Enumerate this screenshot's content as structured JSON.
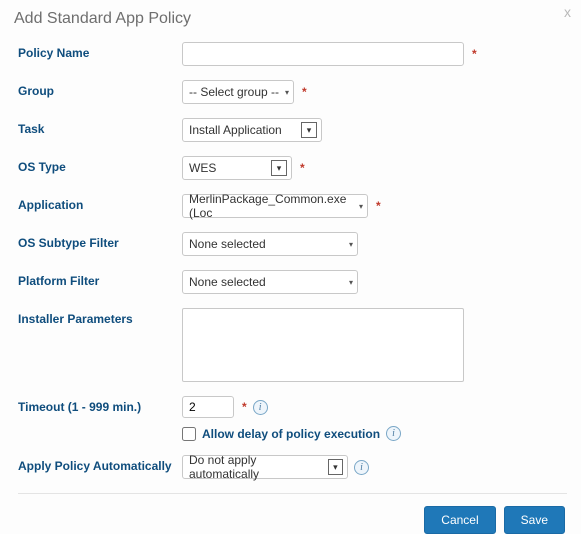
{
  "dialog": {
    "title": "Add Standard App Policy",
    "close_glyph": "x"
  },
  "labels": {
    "policy_name": "Policy Name",
    "group": "Group",
    "task": "Task",
    "os_type": "OS Type",
    "application": "Application",
    "os_subtype_filter": "OS Subtype Filter",
    "platform_filter": "Platform Filter",
    "installer_parameters": "Installer Parameters",
    "timeout": "Timeout (1 - 999 min.)",
    "allow_delay": "Allow delay of policy execution",
    "apply_auto": "Apply Policy Automatically"
  },
  "values": {
    "policy_name": "",
    "group": "-- Select group --",
    "task": "Install Application",
    "os_type": "WES",
    "application": "MerlinPackage_Common.exe (Loc",
    "os_subtype_filter": "None selected",
    "platform_filter": "None selected",
    "installer_parameters": "",
    "timeout": "2",
    "allow_delay_checked": false,
    "apply_auto": "Do not apply automatically"
  },
  "buttons": {
    "cancel": "Cancel",
    "save": "Save"
  },
  "glyphs": {
    "required": "*",
    "info": "i"
  }
}
